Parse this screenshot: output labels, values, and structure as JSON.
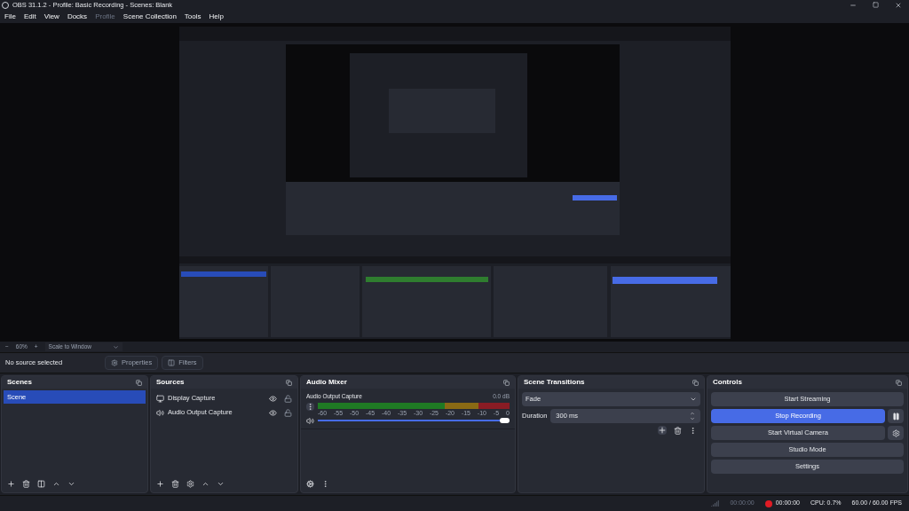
{
  "window": {
    "title": "OBS 31.1.2 - Profile: Basic Recording - Scenes: Blank"
  },
  "menu": [
    {
      "label": "File",
      "disabled": false
    },
    {
      "label": "Edit",
      "disabled": false
    },
    {
      "label": "View",
      "disabled": false
    },
    {
      "label": "Docks",
      "disabled": false
    },
    {
      "label": "Profile",
      "disabled": true
    },
    {
      "label": "Scene Collection",
      "disabled": false
    },
    {
      "label": "Tools",
      "disabled": false
    },
    {
      "label": "Help",
      "disabled": false
    }
  ],
  "zoom_bar": {
    "minus": "−",
    "zoom": "60%",
    "plus": "+",
    "scale": "Scale to Window"
  },
  "source_toolbar": {
    "status": "No source selected",
    "properties": "Properties",
    "filters": "Filters"
  },
  "scenes": {
    "title": "Scenes",
    "items": [
      {
        "label": "Scene",
        "selected": true
      }
    ]
  },
  "sources": {
    "title": "Sources",
    "items": [
      {
        "label": "Display Capture",
        "kind": "display",
        "visible": true,
        "locked": false
      },
      {
        "label": "Audio Output Capture",
        "kind": "audio",
        "visible": true,
        "locked": false
      }
    ]
  },
  "audio_mixer": {
    "title": "Audio Mixer",
    "channels": [
      {
        "name": "Audio Output Capture",
        "reading": "0.0 dB",
        "muted": false,
        "level": 1
      }
    ],
    "ticks": [
      "-60",
      "-55",
      "-50",
      "-45",
      "-40",
      "-35",
      "-30",
      "-25",
      "-20",
      "-15",
      "-10",
      "-5",
      "0"
    ]
  },
  "transitions": {
    "title": "Scene Transitions",
    "selected": "Fade",
    "duration_label": "Duration",
    "duration": "300 ms"
  },
  "controls": {
    "title": "Controls",
    "buttons": [
      {
        "label": "Start Streaming",
        "active": false,
        "kind": "plain"
      },
      {
        "label": "Stop Recording",
        "active": true,
        "kind": "pause"
      },
      {
        "label": "Start Virtual Camera",
        "active": false,
        "kind": "settings"
      },
      {
        "label": "Studio Mode",
        "active": false,
        "kind": "plain"
      },
      {
        "label": "Settings",
        "active": false,
        "kind": "plain"
      }
    ]
  },
  "status_bar": {
    "stream_time": "00:00:00",
    "record_time": "00:00:00",
    "recording": true,
    "cpu": "CPU: 0.7%",
    "fps": "60.00 / 60.00 FPS"
  }
}
